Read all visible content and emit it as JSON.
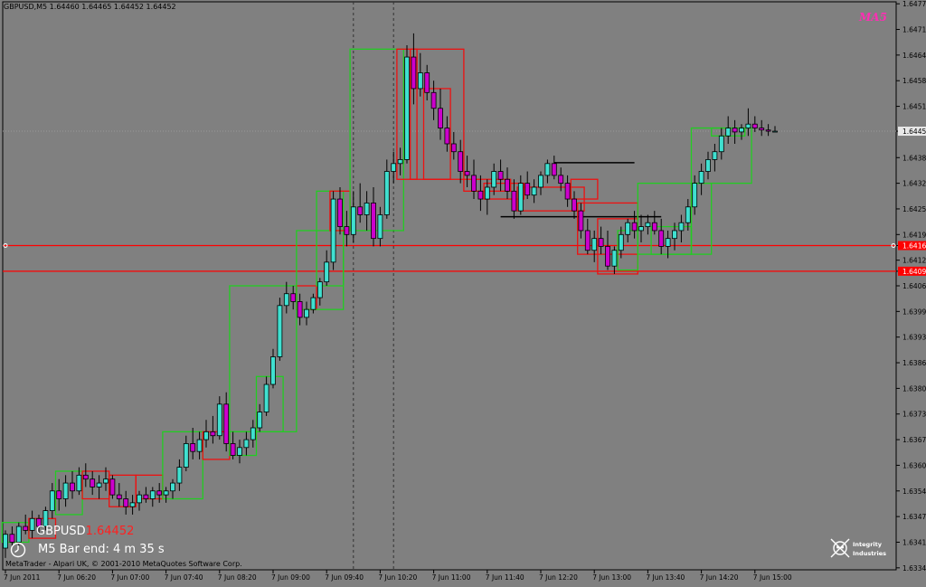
{
  "header": {
    "title": "GBPUSD,M5 1.64460 1.64465 1.64452 1.64452",
    "corner_logo": "MA5"
  },
  "overlay": {
    "symbol": "GBPUSD",
    "symbol_price": "1.64452",
    "bar_end": "M5 Bar end: 4 m 35 s",
    "copyright": "MetaTrader - Alpari UK, © 2001-2010 MetaQuotes Software Corp.",
    "pirate_logo_text": "Integrity Industries"
  },
  "colors": {
    "background": "#808080",
    "bull_box": "#22cc22",
    "bear_box": "#ee1111",
    "bull_candle": "#40e0d0",
    "bear_candle": "#cc00cc",
    "level_line": "#ff0000",
    "grid": "#6e6e6e",
    "axis_text": "#000000"
  },
  "chart_data": {
    "type": "candlestick",
    "symbol": "GBPUSD",
    "timeframe": "M5",
    "ylim": [
      1.6334,
      1.6478
    ],
    "y_ticks": [
      "1.64775",
      "1.64710",
      "1.64645",
      "1.64580",
      "1.64515",
      "1.64452",
      "1.64385",
      "1.64320",
      "1.64255",
      "1.64190",
      "1.64162",
      "1.64125",
      "1.64097",
      "1.64060",
      "1.63995",
      "1.63930",
      "1.63865",
      "1.63800",
      "1.63735",
      "1.63670",
      "1.63605",
      "1.63540",
      "1.63475",
      "1.63410",
      "1.63345"
    ],
    "y_tick_values": [
      1.64775,
      1.6471,
      1.64645,
      1.6458,
      1.64515,
      1.64452,
      1.64385,
      1.6432,
      1.64255,
      1.6419,
      1.64162,
      1.64125,
      1.64097,
      1.6406,
      1.63995,
      1.6393,
      1.63865,
      1.638,
      1.63735,
      1.6367,
      1.63605,
      1.6354,
      1.63475,
      1.6341,
      1.63345
    ],
    "highlighted_ticks": {
      "1.64452": "current",
      "1.64162": "level",
      "1.64097": "level"
    },
    "x_ticks": [
      "7 Jun 2011",
      "7 Jun 06:20",
      "7 Jun 07:00",
      "7 Jun 07:40",
      "7 Jun 08:20",
      "7 Jun 09:00",
      "7 Jun 09:40",
      "7 Jun 10:20",
      "7 Jun 11:00",
      "7 Jun 11:40",
      "7 Jun 12:20",
      "7 Jun 13:00",
      "7 Jun 13:40",
      "7 Jun 14:20",
      "7 Jun 15:00"
    ],
    "x_tick_positions": [
      0,
      8,
      16,
      24,
      32,
      40,
      48,
      56,
      64,
      72,
      80,
      88,
      96,
      104,
      112
    ],
    "bar_count": 116,
    "current_price": 1.64452,
    "horizontal_levels": [
      1.64162,
      1.64097
    ],
    "black_lines": [
      {
        "from": 82,
        "to": 94,
        "price": 1.64372
      },
      {
        "from": 74,
        "to": 98,
        "price": 1.64235
      }
    ],
    "vertical_markers": [
      52,
      58
    ],
    "candles": [
      [
        1.63395,
        1.6344,
        1.6337,
        1.6343
      ],
      [
        1.6343,
        1.6345,
        1.634,
        1.6341
      ],
      [
        1.6341,
        1.6346,
        1.634,
        1.6345
      ],
      [
        1.6345,
        1.6348,
        1.6343,
        1.6344
      ],
      [
        1.6344,
        1.6349,
        1.6342,
        1.6347
      ],
      [
        1.6347,
        1.6348,
        1.6343,
        1.6345
      ],
      [
        1.6345,
        1.635,
        1.6344,
        1.6349
      ],
      [
        1.6349,
        1.6356,
        1.6347,
        1.6354
      ],
      [
        1.6354,
        1.6357,
        1.6349,
        1.6352
      ],
      [
        1.6352,
        1.6358,
        1.635,
        1.6356
      ],
      [
        1.6356,
        1.6359,
        1.6352,
        1.6354
      ],
      [
        1.6354,
        1.636,
        1.6353,
        1.6358
      ],
      [
        1.6358,
        1.6361,
        1.6355,
        1.6357
      ],
      [
        1.6357,
        1.6359,
        1.6353,
        1.6355
      ],
      [
        1.6355,
        1.6358,
        1.6352,
        1.6356
      ],
      [
        1.6356,
        1.636,
        1.6354,
        1.6357
      ],
      [
        1.6357,
        1.6358,
        1.6352,
        1.6353
      ],
      [
        1.6353,
        1.6356,
        1.635,
        1.6352
      ],
      [
        1.6352,
        1.6354,
        1.6348,
        1.635
      ],
      [
        1.635,
        1.6353,
        1.6348,
        1.6351
      ],
      [
        1.6351,
        1.6354,
        1.6349,
        1.6353
      ],
      [
        1.6353,
        1.6355,
        1.6351,
        1.6352
      ],
      [
        1.6352,
        1.6355,
        1.635,
        1.6354
      ],
      [
        1.6354,
        1.6356,
        1.6351,
        1.6353
      ],
      [
        1.6353,
        1.6355,
        1.6351,
        1.6354
      ],
      [
        1.6354,
        1.6357,
        1.6352,
        1.6356
      ],
      [
        1.6356,
        1.6362,
        1.6354,
        1.636
      ],
      [
        1.636,
        1.6368,
        1.6359,
        1.6366
      ],
      [
        1.6366,
        1.637,
        1.6362,
        1.6364
      ],
      [
        1.6364,
        1.6369,
        1.6362,
        1.6367
      ],
      [
        1.6367,
        1.6372,
        1.6365,
        1.6369
      ],
      [
        1.6369,
        1.6373,
        1.6366,
        1.6368
      ],
      [
        1.6368,
        1.6378,
        1.6367,
        1.6376
      ],
      [
        1.6376,
        1.6379,
        1.6364,
        1.6366
      ],
      [
        1.6366,
        1.6369,
        1.6362,
        1.6363
      ],
      [
        1.6363,
        1.6367,
        1.6361,
        1.6365
      ],
      [
        1.6365,
        1.6369,
        1.6363,
        1.6367
      ],
      [
        1.6367,
        1.6372,
        1.6365,
        1.637
      ],
      [
        1.637,
        1.6376,
        1.6369,
        1.6374
      ],
      [
        1.6374,
        1.6383,
        1.6373,
        1.6381
      ],
      [
        1.6381,
        1.639,
        1.638,
        1.6388
      ],
      [
        1.6388,
        1.6403,
        1.6387,
        1.6401
      ],
      [
        1.6401,
        1.6407,
        1.6399,
        1.6404
      ],
      [
        1.6404,
        1.6406,
        1.64,
        1.6402
      ],
      [
        1.6402,
        1.6404,
        1.6396,
        1.6398
      ],
      [
        1.6398,
        1.6402,
        1.6396,
        1.64
      ],
      [
        1.64,
        1.6404,
        1.6399,
        1.6403
      ],
      [
        1.6403,
        1.6408,
        1.6401,
        1.6407
      ],
      [
        1.6407,
        1.6415,
        1.6406,
        1.6412
      ],
      [
        1.6412,
        1.643,
        1.641,
        1.6428
      ],
      [
        1.6428,
        1.6431,
        1.6419,
        1.6421
      ],
      [
        1.6421,
        1.6425,
        1.6416,
        1.6419
      ],
      [
        1.6419,
        1.643,
        1.6417,
        1.6426
      ],
      [
        1.6426,
        1.6432,
        1.6422,
        1.6424
      ],
      [
        1.6424,
        1.643,
        1.642,
        1.6427
      ],
      [
        1.6427,
        1.6431,
        1.6416,
        1.6418
      ],
      [
        1.6418,
        1.6426,
        1.6416,
        1.6424
      ],
      [
        1.6424,
        1.6438,
        1.6423,
        1.6435
      ],
      [
        1.6435,
        1.644,
        1.6432,
        1.6437
      ],
      [
        1.6437,
        1.6441,
        1.6434,
        1.6438
      ],
      [
        1.6438,
        1.6467,
        1.6437,
        1.6464
      ],
      [
        1.6464,
        1.647,
        1.6452,
        1.6456
      ],
      [
        1.6456,
        1.6465,
        1.6454,
        1.646
      ],
      [
        1.646,
        1.6462,
        1.6453,
        1.6455
      ],
      [
        1.6455,
        1.6458,
        1.6448,
        1.6451
      ],
      [
        1.6451,
        1.6456,
        1.6443,
        1.6446
      ],
      [
        1.6446,
        1.6449,
        1.644,
        1.6442
      ],
      [
        1.6442,
        1.6445,
        1.6438,
        1.644
      ],
      [
        1.644,
        1.6443,
        1.6432,
        1.6435
      ],
      [
        1.6435,
        1.6439,
        1.6431,
        1.6434
      ],
      [
        1.6434,
        1.6438,
        1.6428,
        1.643
      ],
      [
        1.643,
        1.6434,
        1.6425,
        1.6428
      ],
      [
        1.6428,
        1.6433,
        1.6424,
        1.6431
      ],
      [
        1.6431,
        1.6437,
        1.6429,
        1.6435
      ],
      [
        1.6435,
        1.6438,
        1.643,
        1.6433
      ],
      [
        1.6433,
        1.6436,
        1.6428,
        1.643
      ],
      [
        1.643,
        1.6433,
        1.6423,
        1.6425
      ],
      [
        1.6425,
        1.6434,
        1.6424,
        1.6432
      ],
      [
        1.6432,
        1.6435,
        1.6428,
        1.6429
      ],
      [
        1.6429,
        1.6433,
        1.6427,
        1.6431
      ],
      [
        1.6431,
        1.6435,
        1.6429,
        1.6434
      ],
      [
        1.6434,
        1.6438,
        1.6432,
        1.6437
      ],
      [
        1.6437,
        1.6439,
        1.6433,
        1.6434
      ],
      [
        1.6434,
        1.6436,
        1.643,
        1.6432
      ],
      [
        1.6432,
        1.6434,
        1.6426,
        1.6428
      ],
      [
        1.6428,
        1.643,
        1.6423,
        1.6425
      ],
      [
        1.6425,
        1.6427,
        1.6418,
        1.642
      ],
      [
        1.642,
        1.6423,
        1.6414,
        1.6415
      ],
      [
        1.6415,
        1.642,
        1.6412,
        1.6418
      ],
      [
        1.6418,
        1.6421,
        1.6414,
        1.6416
      ],
      [
        1.6416,
        1.642,
        1.641,
        1.6411
      ],
      [
        1.6411,
        1.6416,
        1.6409,
        1.6415
      ],
      [
        1.6415,
        1.6421,
        1.6413,
        1.6419
      ],
      [
        1.6419,
        1.6423,
        1.6417,
        1.6422
      ],
      [
        1.6422,
        1.6425,
        1.6418,
        1.642
      ],
      [
        1.642,
        1.6424,
        1.6417,
        1.6421
      ],
      [
        1.6421,
        1.6424,
        1.6419,
        1.6422
      ],
      [
        1.6422,
        1.6425,
        1.6419,
        1.642
      ],
      [
        1.642,
        1.6423,
        1.6414,
        1.6416
      ],
      [
        1.6416,
        1.642,
        1.6413,
        1.6418
      ],
      [
        1.6418,
        1.6422,
        1.6415,
        1.642
      ],
      [
        1.642,
        1.6424,
        1.6417,
        1.6422
      ],
      [
        1.6422,
        1.6428,
        1.642,
        1.6426
      ],
      [
        1.6426,
        1.6434,
        1.6424,
        1.6432
      ],
      [
        1.6432,
        1.6437,
        1.6429,
        1.6435
      ],
      [
        1.6435,
        1.644,
        1.6433,
        1.6438
      ],
      [
        1.6438,
        1.6442,
        1.6435,
        1.644
      ],
      [
        1.644,
        1.6446,
        1.6438,
        1.6444
      ],
      [
        1.6444,
        1.6449,
        1.6442,
        1.6446
      ],
      [
        1.6446,
        1.6448,
        1.6442,
        1.6445
      ],
      [
        1.6445,
        1.6447,
        1.6443,
        1.6446
      ],
      [
        1.6446,
        1.6451,
        1.6444,
        1.6447
      ],
      [
        1.6447,
        1.6449,
        1.6445,
        1.6446
      ],
      [
        1.6446,
        1.6448,
        1.6444,
        1.64455
      ],
      [
        1.64455,
        1.6447,
        1.6444,
        1.64452
      ],
      [
        1.64452,
        1.64465,
        1.6445,
        1.64452
      ]
    ],
    "boxes": [
      {
        "from": 0,
        "to": 3,
        "high": 1.6346,
        "low": 1.6341,
        "dir": "bull"
      },
      {
        "from": 4,
        "to": 7,
        "high": 1.6347,
        "low": 1.6342,
        "dir": "bear"
      },
      {
        "from": 8,
        "to": 11,
        "high": 1.6359,
        "low": 1.6348,
        "dir": "bull"
      },
      {
        "from": 12,
        "to": 15,
        "high": 1.6359,
        "low": 1.6352,
        "dir": "bear"
      },
      {
        "from": 16,
        "to": 19,
        "high": 1.6358,
        "low": 1.635,
        "dir": "bear"
      },
      {
        "from": 20,
        "to": 23,
        "high": 1.6358,
        "low": 1.6352,
        "dir": "bear"
      },
      {
        "from": 24,
        "to": 29,
        "high": 1.6369,
        "low": 1.6352,
        "dir": "bull"
      },
      {
        "from": 30,
        "to": 33,
        "high": 1.6369,
        "low": 1.6362,
        "dir": "bear"
      },
      {
        "from": 34,
        "to": 37,
        "high": 1.6369,
        "low": 1.6363,
        "dir": "bull"
      },
      {
        "from": 38,
        "to": 41,
        "high": 1.6383,
        "low": 1.6369,
        "dir": "bull"
      },
      {
        "from": 34,
        "to": 43,
        "high": 1.6406,
        "low": 1.6369,
        "dir": "bull"
      },
      {
        "from": 44,
        "to": 46,
        "high": 1.6406,
        "low": 1.64,
        "dir": "bear"
      },
      {
        "from": 44,
        "to": 50,
        "high": 1.642,
        "low": 1.64,
        "dir": "bull"
      },
      {
        "from": 47,
        "to": 50,
        "high": 1.643,
        "low": 1.6406,
        "dir": "bull"
      },
      {
        "from": 49,
        "to": 51,
        "high": 1.643,
        "low": 1.642,
        "dir": "bear"
      },
      {
        "from": 52,
        "to": 59,
        "high": 1.6466,
        "low": 1.642,
        "dir": "bull"
      },
      {
        "from": 59,
        "to": 61,
        "high": 1.6466,
        "low": 1.6433,
        "dir": "bear"
      },
      {
        "from": 61,
        "to": 68,
        "high": 1.6466,
        "low": 1.6433,
        "dir": "bear"
      },
      {
        "from": 63,
        "to": 66,
        "high": 1.6456,
        "low": 1.6433,
        "dir": "bear"
      },
      {
        "from": 69,
        "to": 75,
        "high": 1.6433,
        "low": 1.643,
        "dir": "bear"
      },
      {
        "from": 72,
        "to": 77,
        "high": 1.6432,
        "low": 1.6428,
        "dir": "bear"
      },
      {
        "from": 77,
        "to": 86,
        "high": 1.6431,
        "low": 1.6425,
        "dir": "bear"
      },
      {
        "from": 85,
        "to": 88,
        "high": 1.6433,
        "low": 1.6428,
        "dir": "bear"
      },
      {
        "from": 86,
        "to": 94,
        "high": 1.6427,
        "low": 1.6414,
        "dir": "bear"
      },
      {
        "from": 89,
        "to": 94,
        "high": 1.6423,
        "low": 1.6409,
        "dir": "bear"
      },
      {
        "from": 92,
        "to": 94,
        "high": 1.642,
        "low": 1.641,
        "dir": "bull"
      },
      {
        "from": 95,
        "to": 102,
        "high": 1.6432,
        "low": 1.6414,
        "dir": "bull"
      },
      {
        "from": 97,
        "to": 102,
        "high": 1.6421,
        "low": 1.6414,
        "dir": "bull"
      },
      {
        "from": 103,
        "to": 105,
        "high": 1.6432,
        "low": 1.6414,
        "dir": "bull"
      },
      {
        "from": 103,
        "to": 111,
        "high": 1.6446,
        "low": 1.6432,
        "dir": "bull"
      },
      {
        "from": 106,
        "to": 110,
        "high": 1.6446,
        "low": 1.6444,
        "dir": "bull"
      }
    ]
  }
}
